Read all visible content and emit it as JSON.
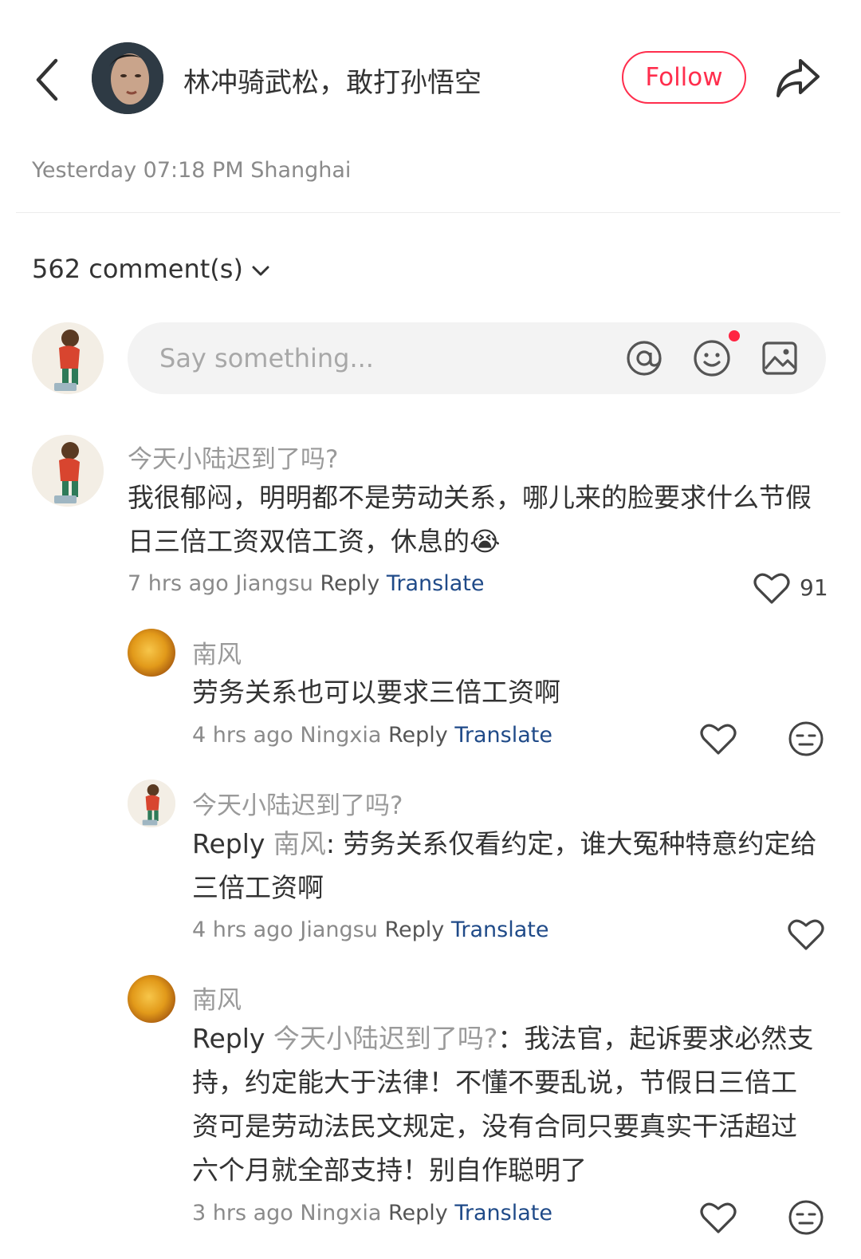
{
  "header": {
    "author_name": "林冲骑武松，敢打孙悟空",
    "follow_label": "Follow"
  },
  "post": {
    "meta": "Yesterday 07:18 PM Shanghai",
    "comment_count": "562 comment(s)"
  },
  "input": {
    "placeholder": "Say something..."
  },
  "comments": [
    {
      "user": "今天小陆迟到了吗?",
      "text": "我很郁闷，明明都不是劳动关系，哪儿来的脸要求什么节假日三倍工资双倍工资，休息的😭",
      "time": "7 hrs ago",
      "location": "Jiangsu",
      "reply_label": "Reply",
      "translate_label": "Translate",
      "likes": "91"
    },
    {
      "user": "南风",
      "text": "劳务关系也可以要求三倍工资啊",
      "time": "4 hrs ago",
      "location": "Ningxia",
      "reply_label": "Reply",
      "translate_label": "Translate"
    },
    {
      "user": "今天小陆迟到了吗?",
      "reply_prefix": "Reply",
      "mention": "南风",
      "text": ": 劳务关系仅看约定，谁大冤种特意约定给三倍工资啊",
      "time": "4 hrs ago",
      "location": "Jiangsu",
      "reply_label": "Reply",
      "translate_label": "Translate"
    },
    {
      "user": "南风",
      "reply_prefix": "Reply",
      "mention": "今天小陆迟到了吗?",
      "text": "：我法官，起诉要求必然支持，约定能大于法律！不懂不要乱说，节假日三倍工资可是劳动法民文规定，没有合同只要真实干活超过六个月就全部支持！别自作聪明了",
      "time": "3 hrs ago",
      "location": "Ningxia",
      "reply_label": "Reply",
      "translate_label": "Translate"
    }
  ]
}
